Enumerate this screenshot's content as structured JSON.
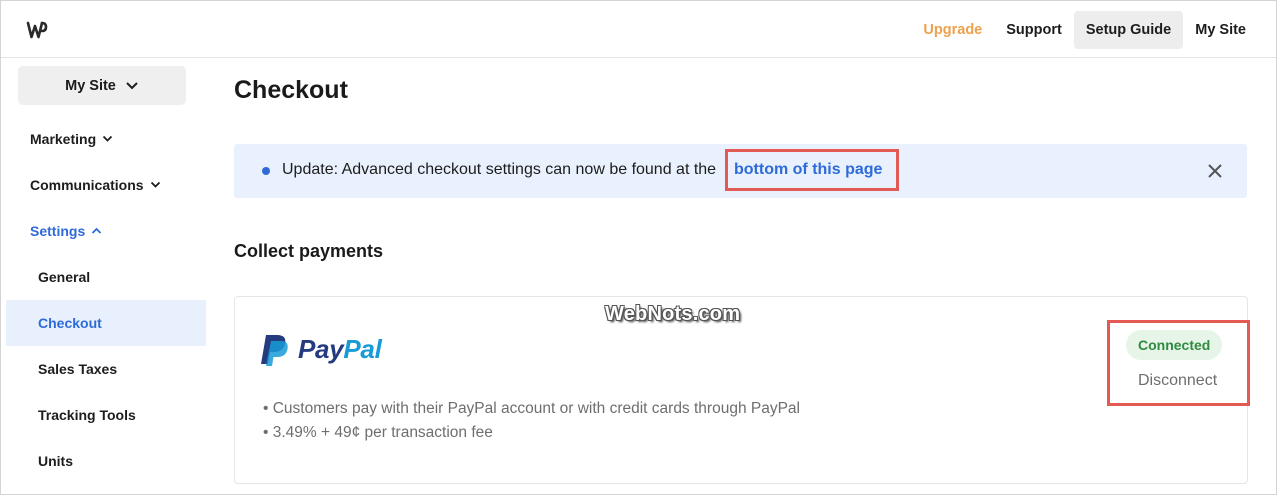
{
  "topbar": {
    "logo_icon": "weebly-w-icon",
    "nav": [
      {
        "label": "Upgrade"
      },
      {
        "label": "Support"
      },
      {
        "label": "Setup Guide"
      },
      {
        "label": "My Site"
      }
    ],
    "upgrade_color": "#eea14c"
  },
  "sidebar": {
    "site_button": "My Site",
    "groups": [
      {
        "label": "Marketing",
        "icon": "chevron-down-icon"
      },
      {
        "label": "Communications",
        "icon": "chevron-down-icon"
      },
      {
        "label": "Settings",
        "icon": "chevron-up-icon"
      }
    ],
    "settings_items": [
      {
        "label": "General"
      },
      {
        "label": "Checkout"
      },
      {
        "label": "Sales Taxes"
      },
      {
        "label": "Tracking Tools"
      },
      {
        "label": "Units"
      }
    ],
    "active_item": "Checkout",
    "accent_color": "#2f6bd8"
  },
  "main": {
    "title": "Checkout",
    "banner": {
      "message": "Update: Advanced checkout settings can now be found at the",
      "link": "bottom of this page",
      "close_icon": "close-icon"
    },
    "section_title": "Collect payments",
    "provider": {
      "name_part1": "Pay",
      "name_part2": "Pal",
      "bullets": [
        "Customers pay with their PayPal account or with credit cards through PayPal",
        "3.49% + 49¢ per transaction fee"
      ],
      "status": "Connected",
      "action": "Disconnect"
    }
  },
  "watermark": "WebNots.com"
}
